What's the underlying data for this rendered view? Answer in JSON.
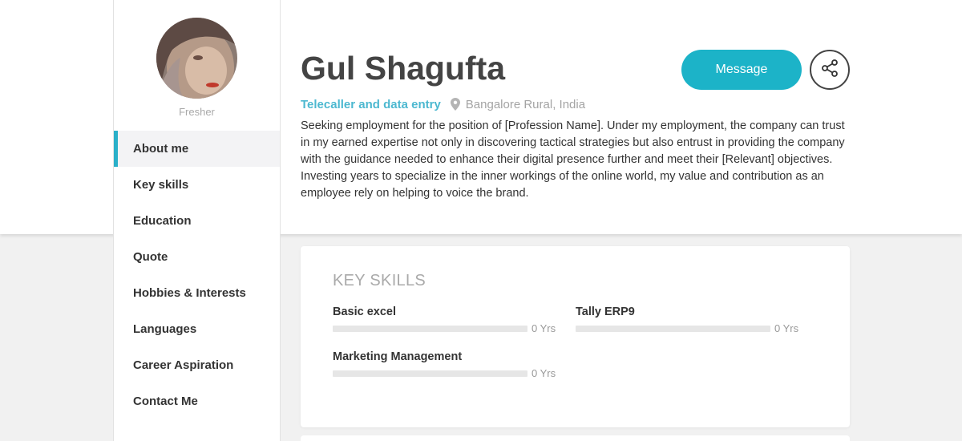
{
  "profile": {
    "name": "Gul Shagufta",
    "job_title": "Telecaller and data entry",
    "location": "Bangalore Rural, India",
    "status": "Fresher",
    "about": "Seeking employment for the position of [Profession Name]. Under my employment, the company can trust in my earned expertise not only in discovering tactical strategies but also entrust in providing the company with the guidance needed to enhance their digital presence further and meet their [Relevant] objectives. Investing years to specialize in the inner workings of the online world, my value and contribution as an employee rely on helping to voice the brand."
  },
  "actions": {
    "message_label": "Message",
    "share_icon": "share-icon"
  },
  "sidebar": {
    "items": [
      {
        "label": "About me",
        "active": true
      },
      {
        "label": "Key skills"
      },
      {
        "label": "Education"
      },
      {
        "label": "Quote"
      },
      {
        "label": "Hobbies & Interests"
      },
      {
        "label": "Languages"
      },
      {
        "label": "Career Aspiration"
      },
      {
        "label": "Contact Me"
      }
    ]
  },
  "key_skills": {
    "heading": "KEY SKILLS",
    "skills": [
      {
        "name": "Basic excel",
        "years": "0 Yrs",
        "level": 0
      },
      {
        "name": "Tally ERP9",
        "years": "0 Yrs",
        "level": 0
      },
      {
        "name": "Marketing Management",
        "years": "0 Yrs",
        "level": 0
      }
    ]
  },
  "colors": {
    "accent": "#1cb3c8",
    "job_title": "#4cb8d0",
    "active_border": "#2ab0c9"
  }
}
